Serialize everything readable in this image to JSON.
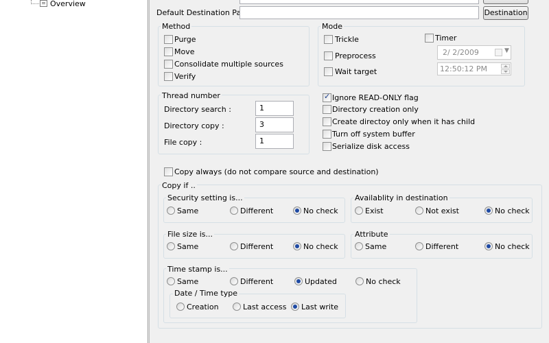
{
  "tree": {
    "overview_label": "Overview"
  },
  "dest": {
    "label": "Default Destination Path :",
    "value": "",
    "button": "Destination"
  },
  "method": {
    "title": "Method",
    "items": [
      {
        "label": "Purge",
        "checked": false
      },
      {
        "label": "Move",
        "checked": false
      },
      {
        "label": "Consolidate multiple sources",
        "checked": false
      },
      {
        "label": "Verify",
        "checked": false
      }
    ]
  },
  "mode": {
    "title": "Mode",
    "trickle": "Trickle",
    "timer": "Timer",
    "preprocess": "Preprocess",
    "wait_target": "Wait target",
    "date_value": "2/  2/2009",
    "time_value": "12:50:12 PM"
  },
  "thread": {
    "title": "Thread number",
    "rows": [
      {
        "label": "Directory search :",
        "value": "1"
      },
      {
        "label": "Directory copy :",
        "value": "3"
      },
      {
        "label": "File copy :",
        "value": "1"
      }
    ]
  },
  "flags": [
    {
      "label": "Ignore READ-ONLY flag",
      "checked": true
    },
    {
      "label": "Directory creation only",
      "checked": false
    },
    {
      "label": "Create directoy only when it has child",
      "checked": false
    },
    {
      "label": "Turn off system buffer",
      "checked": false
    },
    {
      "label": "Serialize disk access",
      "checked": false
    }
  ],
  "copy_always": "Copy always (do not compare source and destination)",
  "copy_if": {
    "title": "Copy if ..",
    "security": {
      "title": "Security setting is...",
      "options": [
        "Same",
        "Different",
        "No check"
      ],
      "selected": 2
    },
    "availability": {
      "title": "Availablity in destination",
      "options": [
        "Exist",
        "Not exist",
        "No check"
      ],
      "selected": 2
    },
    "filesize": {
      "title": "File size is...",
      "options": [
        "Same",
        "Different",
        "No check"
      ],
      "selected": 2
    },
    "attribute": {
      "title": "Attribute",
      "options": [
        "Same",
        "Different",
        "No check"
      ],
      "selected": 2
    },
    "timestamp": {
      "title": "Time stamp is...",
      "options": [
        "Same",
        "Different",
        "Updated",
        "No check"
      ],
      "selected": 2
    },
    "datetime": {
      "title": "Date / Time type",
      "options": [
        "Creation",
        "Last access",
        "Last write"
      ],
      "selected": 2
    }
  }
}
